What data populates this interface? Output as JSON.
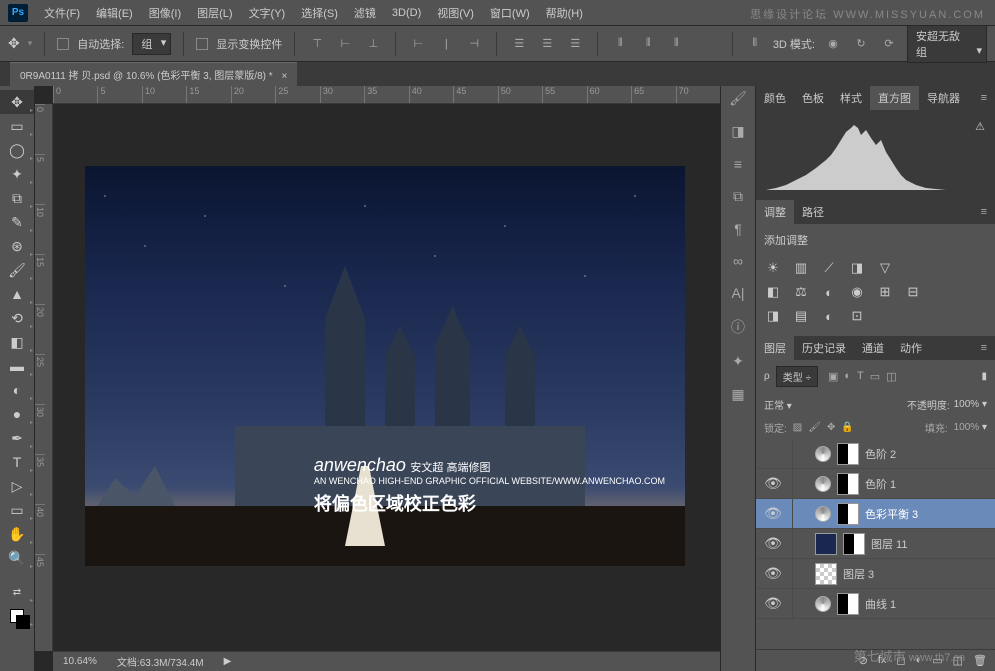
{
  "menu": {
    "file": "文件(F)",
    "edit": "编辑(E)",
    "image": "图像(I)",
    "layer": "图层(L)",
    "text": "文字(Y)",
    "select": "选择(S)",
    "filter": "滤镜",
    "threed": "3D(D)",
    "view": "视图(V)",
    "window": "窗口(W)",
    "help": "帮助(H)"
  },
  "toolbar": {
    "auto_select": "自动选择:",
    "group": "组",
    "show_transform": "显示变换控件",
    "mode_3d": "3D 模式:",
    "preset": "安超无敌组"
  },
  "doc_tab": "0R9A0111 拷 贝.psd @ 10.6% (色彩平衡 3, 图层蒙版/8) *",
  "ruler_h": [
    "0",
    "5",
    "10",
    "15",
    "20",
    "25",
    "30",
    "35",
    "40",
    "45",
    "50",
    "55",
    "60",
    "65",
    "70"
  ],
  "ruler_v": [
    "0",
    "5",
    "10",
    "15",
    "20",
    "25",
    "30",
    "35",
    "40",
    "45"
  ],
  "canvas": {
    "brand": "anwenchao",
    "brand_cn": "安文超 高端修图",
    "sub": "AN WENCHAO HIGH-END GRAPHIC OFFICIAL WEBSITE/WWW.ANWENCHAO.COM",
    "cn_text": "将偏色区域校正色彩"
  },
  "status": {
    "zoom": "10.64%",
    "doc_label": "文档:",
    "doc_size": "63.3M/734.4M"
  },
  "panels": {
    "color_tabs": {
      "color": "颜色",
      "swatches": "色板",
      "styles": "样式",
      "histogram": "直方图",
      "navigator": "导航器"
    },
    "adjust_tabs": {
      "adjust": "调整",
      "paths": "路径"
    },
    "adjust_title": "添加调整",
    "layer_tabs": {
      "layers": "图层",
      "history": "历史记录",
      "channels": "通道",
      "actions": "动作"
    },
    "kind": "类型",
    "blend": "正常",
    "opacity_label": "不透明度:",
    "opacity": "100%",
    "lock_label": "锁定:",
    "fill_label": "填充:",
    "fill": "100%",
    "filter_rho": "ρ"
  },
  "layers": [
    {
      "name": "色阶 2",
      "eye": false,
      "adj": true
    },
    {
      "name": "色阶 1",
      "eye": true,
      "adj": true
    },
    {
      "name": "色彩平衡 3",
      "eye": true,
      "adj": true,
      "selected": true
    },
    {
      "name": "图层 11",
      "eye": true,
      "adj": false,
      "double": true
    },
    {
      "name": "图层 3",
      "eye": true,
      "adj": false
    },
    {
      "name": "曲线 1",
      "eye": true,
      "adj": true
    }
  ],
  "watermark": {
    "top": "思缘设计论坛  WWW.MISSYUAN.COM",
    "bottom_cn": "第七城市",
    "bottom_en": "www.th7.cn"
  }
}
